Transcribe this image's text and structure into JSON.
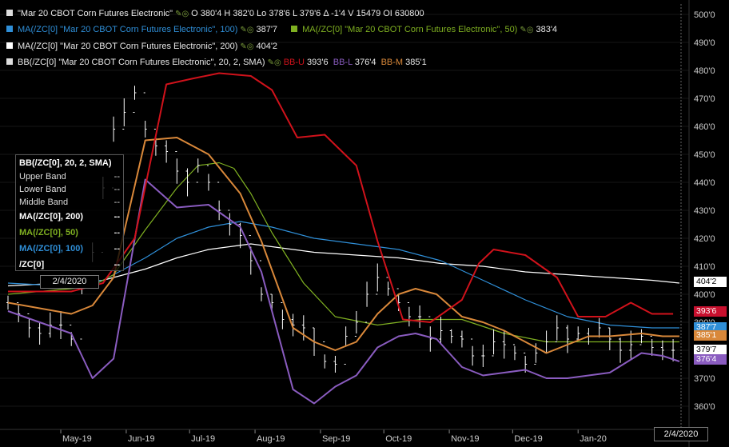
{
  "legend": {
    "row1": {
      "name": "\"Mar 20 CBOT Corn Futures Electronic\"",
      "stats": "O 380'4  H 382'0  Lo 378'6  L 379'6  Δ -1'4  V 15479  OI 630800",
      "color": "#dddddd"
    },
    "row2a": {
      "name": "MA(/ZC[0] \"Mar 20 CBOT Corn Futures Electronic\", 100)",
      "value": "387'7",
      "color": "#2f8fd8"
    },
    "row2b": {
      "name": "MA(/ZC[0] \"Mar 20 CBOT Corn Futures Electronic\", 50)",
      "value": "383'4",
      "color": "#7fb021"
    },
    "row3": {
      "name": "MA(/ZC[0] \"Mar 20 CBOT Corn Futures Electronic\", 200)",
      "value": "404'2",
      "color": "#ffffff"
    },
    "row4": {
      "name": "BB(/ZC[0] \"Mar 20 CBOT Corn Futures Electronic\", 20, 2, SMA)",
      "u_label": "BB-U",
      "u_value": "393'6",
      "l_label": "BB-L",
      "l_value": "376'4",
      "m_label": "BB-M",
      "m_value": "385'1",
      "color": "#dddddd"
    }
  },
  "tooltip": {
    "title": "BB(/ZC[0], 20, 2, SMA)",
    "upper": "Upper Band",
    "lower": "Lower Band",
    "middle": "Middle Band",
    "ma200": "MA(/ZC[0], 200)",
    "ma50": "MA(/ZC[0], 50)",
    "ma100": "MA(/ZC[0], 100)",
    "sym": "/ZC[0]",
    "dash": "--",
    "date": "2/4/2020"
  },
  "cursor_date": "2/4/2020",
  "price_tags": [
    {
      "text": "404'2",
      "bg": "#ffffff",
      "fg": "#000000"
    },
    {
      "text": "393'6",
      "bg": "#c8102e",
      "fg": "#ffffff"
    },
    {
      "text": "387'7",
      "bg": "#2f8fd8",
      "fg": "#ffffff"
    },
    {
      "text": "385'1",
      "bg": "#d9883a",
      "fg": "#ffffff"
    },
    {
      "text": "379'7",
      "bg": "#ffffff",
      "fg": "#000000"
    },
    {
      "text": "376'4",
      "bg": "#8a5cc0",
      "fg": "#ffffff"
    }
  ],
  "chart_data": {
    "type": "line",
    "title": "\"Mar 20 CBOT Corn Futures Electronic\"",
    "x_ticks": [
      "May-19",
      "Jun-19",
      "Jul-19",
      "Aug-19",
      "Sep-19",
      "Oct-19",
      "Nov-19",
      "Dec-19",
      "Jan-20"
    ],
    "y_ticks": [
      "360'0",
      "370'0",
      "380'0",
      "390'0",
      "400'0",
      "410'0",
      "420'0",
      "430'0",
      "440'0",
      "450'0",
      "460'0",
      "470'0",
      "480'0",
      "490'0",
      "500'0"
    ],
    "ylim": [
      356,
      502
    ],
    "x_days_range": [
      -25,
      293
    ],
    "grid": true,
    "series": [
      {
        "name": "BB-U",
        "color": "#d0121b",
        "x": [
          -25,
          5,
          20,
          35,
          50,
          62,
          75,
          90,
          100,
          112,
          125,
          140,
          150,
          162,
          175,
          190,
          198,
          205,
          220,
          235,
          245,
          258,
          270,
          280,
          290
        ],
        "y": [
          401,
          401,
          404,
          420,
          475,
          477,
          479,
          478,
          473,
          456,
          457,
          446,
          419,
          391,
          390,
          398,
          411,
          416,
          414,
          406,
          392,
          392,
          397,
          393,
          393
        ]
      },
      {
        "name": "BB-L",
        "color": "#8a5cc0",
        "x": [
          -25,
          5,
          15,
          25,
          40,
          55,
          70,
          85,
          95,
          110,
          120,
          130,
          140,
          150,
          160,
          168,
          178,
          190,
          200,
          210,
          220,
          230,
          240,
          250,
          260,
          275,
          285,
          293
        ],
        "y": [
          394,
          386,
          370,
          377,
          441,
          431,
          432,
          424,
          408,
          366,
          361,
          367,
          371,
          381,
          385,
          386,
          384,
          374,
          371,
          372,
          373,
          370,
          370,
          371,
          372,
          379,
          378,
          376
        ]
      },
      {
        "name": "BB-M",
        "color": "#d9883a",
        "x": [
          -25,
          5,
          15,
          25,
          40,
          55,
          70,
          85,
          95,
          110,
          120,
          130,
          140,
          150,
          160,
          168,
          178,
          190,
          200,
          210,
          220,
          230,
          240,
          250,
          260,
          275,
          285,
          293
        ],
        "y": [
          397,
          393,
          396,
          406,
          455,
          456,
          450,
          436,
          419,
          388,
          383,
          380,
          383,
          393,
          400,
          402,
          400,
          392,
          390,
          387,
          383,
          379,
          382,
          385,
          385,
          386,
          385,
          385
        ]
      },
      {
        "name": "MA 50",
        "color": "#7fb021",
        "x": [
          -25,
          5,
          15,
          25,
          40,
          55,
          65,
          75,
          82,
          90,
          100,
          115,
          130,
          150,
          170,
          190,
          210,
          230,
          250,
          270,
          293
        ],
        "y": [
          400,
          402,
          403,
          407,
          423,
          438,
          446,
          447,
          445,
          436,
          422,
          404,
          392,
          389,
          391,
          391,
          386,
          383,
          383,
          383,
          383
        ]
      },
      {
        "name": "MA 100",
        "color": "#2f8fd8",
        "x": [
          -25,
          0,
          20,
          40,
          55,
          70,
          85,
          100,
          120,
          140,
          160,
          180,
          200,
          220,
          240,
          260,
          280,
          293
        ],
        "y": [
          404,
          403,
          405,
          413,
          420,
          424,
          426,
          424,
          420,
          418,
          416,
          412,
          405,
          398,
          392,
          389,
          388,
          388
        ]
      },
      {
        "name": "MA 200",
        "color": "#ffffff",
        "x": [
          -25,
          0,
          20,
          40,
          55,
          70,
          90,
          100,
          120,
          140,
          160,
          180,
          200,
          220,
          240,
          260,
          280,
          293
        ],
        "y": [
          403,
          404,
          405,
          409,
          413,
          416,
          418,
          417,
          415,
          414,
          413,
          411,
          410,
          408,
          407,
          406,
          405,
          404
        ]
      },
      {
        "name": "/ZC[0]",
        "color": "#ffffff",
        "type": "ohlc",
        "x": [
          -25,
          -20,
          -15,
          -10,
          -5,
          0,
          5,
          10,
          15,
          20,
          25,
          30,
          35,
          40,
          45,
          50,
          55,
          60,
          65,
          70,
          75,
          80,
          85,
          90,
          95,
          100,
          105,
          110,
          115,
          120,
          125,
          130,
          135,
          140,
          145,
          150,
          155,
          160,
          165,
          170,
          175,
          180,
          185,
          190,
          195,
          200,
          205,
          210,
          215,
          220,
          225,
          230,
          235,
          240,
          245,
          250,
          255,
          260,
          265,
          270,
          275,
          280,
          285,
          290
        ],
        "y": [
          397,
          393,
          388,
          386,
          389,
          389,
          384,
          403,
          415,
          438,
          459,
          465,
          472,
          459,
          453,
          451,
          444,
          440,
          446,
          440,
          430,
          425,
          421,
          412,
          400,
          397,
          391,
          389,
          388,
          383,
          376,
          375,
          385,
          390,
          400,
          406,
          402,
          397,
          392,
          392,
          384,
          387,
          385,
          384,
          378,
          378,
          383,
          382,
          379,
          375,
          379,
          383,
          388,
          384,
          386,
          385,
          388,
          384,
          380,
          382,
          385,
          381,
          380,
          380
        ]
      }
    ]
  }
}
